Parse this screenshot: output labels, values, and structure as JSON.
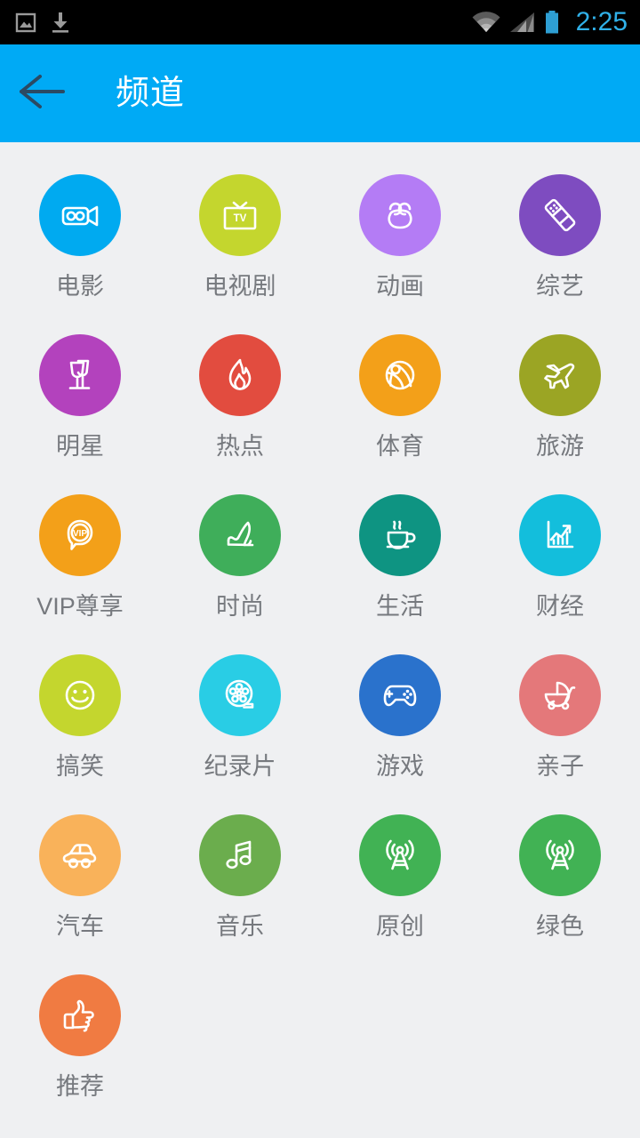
{
  "status_bar": {
    "time": "2:25",
    "time_color": "#30B0E8",
    "background": "#000000",
    "left_icons": [
      {
        "name": "screenshot-image-icon",
        "label": "screenshot"
      },
      {
        "name": "download-icon",
        "label": "download"
      }
    ],
    "right_icons": [
      {
        "name": "wifi-icon",
        "label": "wifi"
      },
      {
        "name": "cellular-signal-icon",
        "label": "signal"
      },
      {
        "name": "battery-icon",
        "label": "battery"
      }
    ]
  },
  "app_bar": {
    "title": "频道",
    "background": "#00AAF5",
    "title_color": "#FFFFFF",
    "back_icon": "back-arrow-icon",
    "back_arrow_color": "#2B4A63"
  },
  "page": {
    "background": "#EFF0F2",
    "label_color": "#76797E"
  },
  "channels": [
    {
      "label": "电影",
      "icon": "video-camera-icon",
      "color": "#00AAF0"
    },
    {
      "label": "电视剧",
      "icon": "television-icon",
      "color": "#C4D62E"
    },
    {
      "label": "动画",
      "icon": "bear-face-icon",
      "color": "#B47CF5"
    },
    {
      "label": "综艺",
      "icon": "remote-control-icon",
      "color": "#7E4CC0"
    },
    {
      "label": "明星",
      "icon": "wine-glasses-icon",
      "color": "#B342BD"
    },
    {
      "label": "热点",
      "icon": "flame-icon",
      "color": "#E24C3F"
    },
    {
      "label": "体育",
      "icon": "basketball-icon",
      "color": "#F3A019"
    },
    {
      "label": "旅游",
      "icon": "airplane-icon",
      "color": "#9BA524"
    },
    {
      "label": "VIP尊享",
      "icon": "vip-badge-icon",
      "color": "#F3A019"
    },
    {
      "label": "时尚",
      "icon": "high-heel-shoe-icon",
      "color": "#3FAE5A"
    },
    {
      "label": "生活",
      "icon": "coffee-cup-icon",
      "color": "#0E9482"
    },
    {
      "label": "财经",
      "icon": "growth-chart-icon",
      "color": "#13BEDC"
    },
    {
      "label": "搞笑",
      "icon": "smiley-face-icon",
      "color": "#C4D62E"
    },
    {
      "label": "纪录片",
      "icon": "film-reel-icon",
      "color": "#29CDE5"
    },
    {
      "label": "游戏",
      "icon": "gamepad-icon",
      "color": "#2A72CC"
    },
    {
      "label": "亲子",
      "icon": "baby-stroller-icon",
      "color": "#E4787A"
    },
    {
      "label": "汽车",
      "icon": "car-icon",
      "color": "#F9B25A"
    },
    {
      "label": "音乐",
      "icon": "music-note-icon",
      "color": "#6BAD4D"
    },
    {
      "label": "原创",
      "icon": "broadcast-tower-icon",
      "color": "#41B254"
    },
    {
      "label": "绿色",
      "icon": "broadcast-tower-icon",
      "color": "#41B254"
    },
    {
      "label": "推荐",
      "icon": "thumbs-up-icon",
      "color": "#F07B42"
    }
  ]
}
